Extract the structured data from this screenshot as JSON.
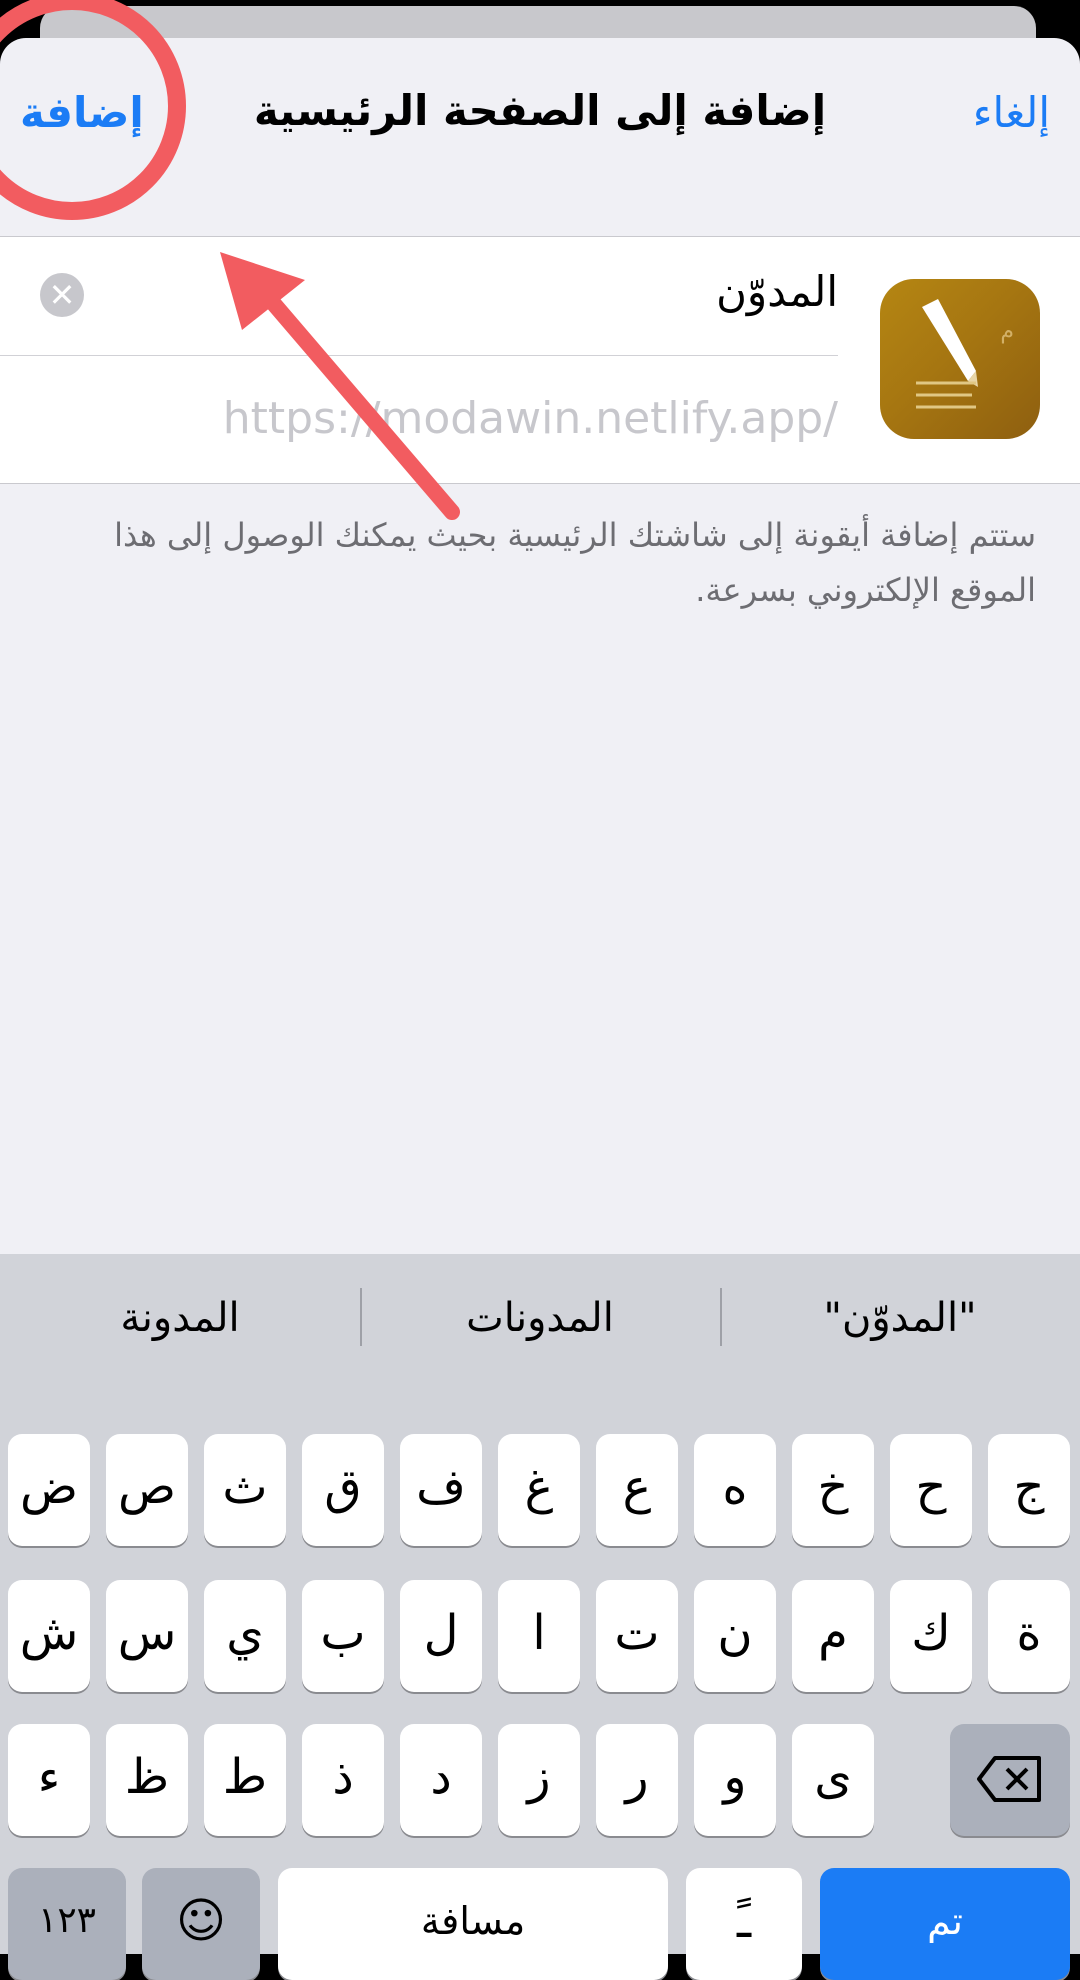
{
  "nav": {
    "add_label": "إضافة",
    "title": "إضافة إلى الصفحة الرئيسية",
    "cancel_label": "إلغاء"
  },
  "card": {
    "name_value": "المدوّن",
    "url_value": "https://modawin.netlify.app/",
    "clear_glyph": "✕",
    "icon_mark": "م"
  },
  "description": "ستتم إضافة أيقونة إلى شاشتك الرئيسية بحيث يمكنك الوصول إلى هذا الموقع الإلكتروني بسرعة.",
  "keyboard": {
    "suggestions": [
      "\"المدوّن\"",
      "المدونات",
      "المدونة"
    ],
    "row1": [
      "ج",
      "ح",
      "خ",
      "ه",
      "ع",
      "غ",
      "ف",
      "ق",
      "ث",
      "ص",
      "ض"
    ],
    "row2": [
      "ة",
      "ك",
      "م",
      "ن",
      "ت",
      "ا",
      "ل",
      "ب",
      "ي",
      "س",
      "ش"
    ],
    "row3": [
      "ى",
      "و",
      "ر",
      "ز",
      "د",
      "ذ",
      "ط",
      "ظ",
      "ء"
    ],
    "bottom": {
      "numbers": "١٢٣",
      "emoji": "☺",
      "space": "مسافة",
      "tanween": "ـً",
      "return": "تم"
    }
  },
  "colors": {
    "accent": "#1b7cf5",
    "annotation": "#f25c60"
  }
}
